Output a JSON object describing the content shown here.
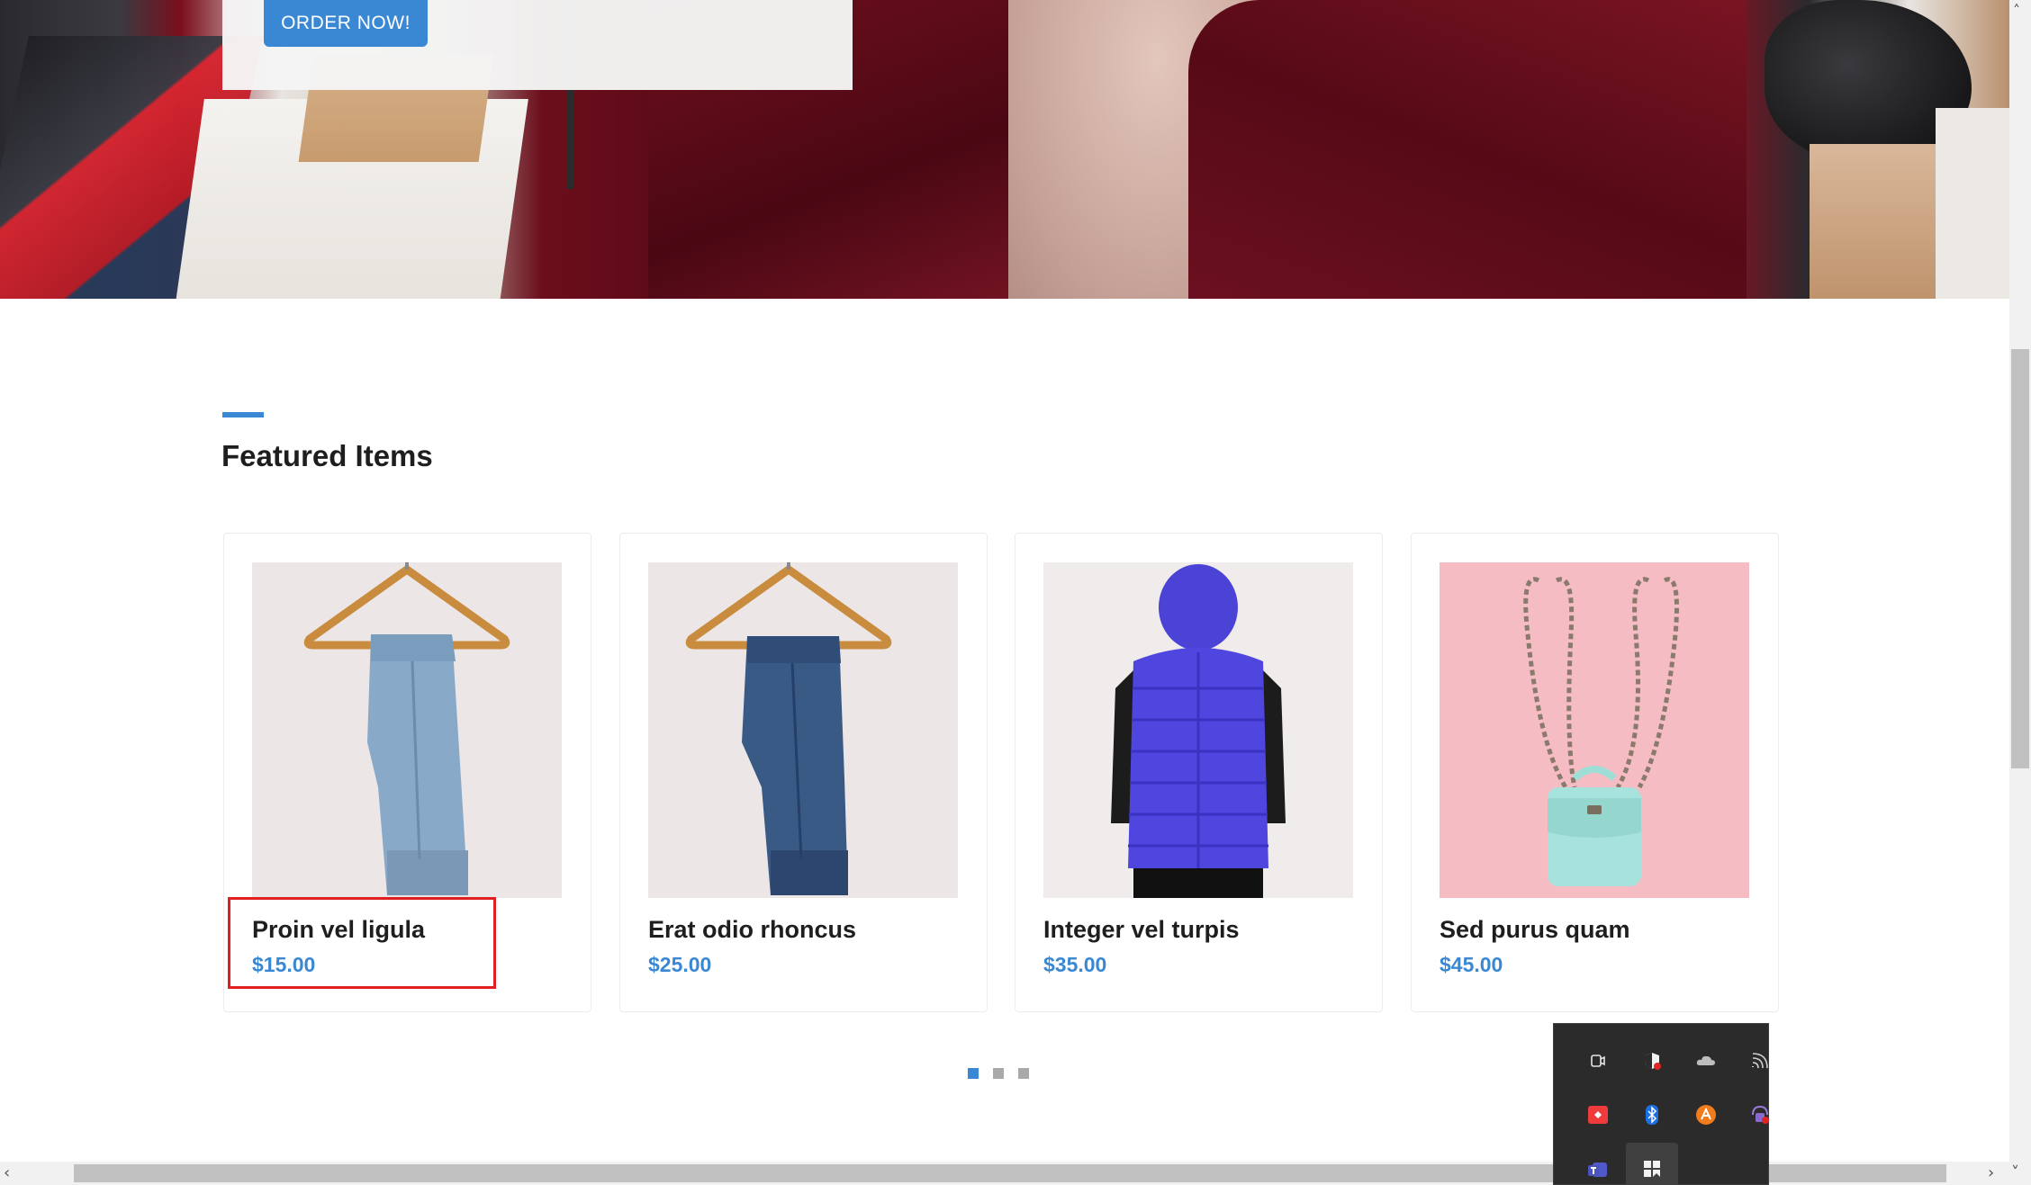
{
  "hero": {
    "order_button_label": "ORDER NOW!"
  },
  "featured": {
    "title": "Featured Items",
    "items": [
      {
        "name": "Proin vel ligula",
        "price": "$15.00",
        "image": "light-jeans-on-hanger"
      },
      {
        "name": "Erat odio rhoncus",
        "price": "$25.00",
        "image": "dark-jeans-on-hanger"
      },
      {
        "name": "Integer vel turpis",
        "price": "$35.00",
        "image": "blue-puffer-vest"
      },
      {
        "name": "Sed purus quam",
        "price": "$45.00",
        "image": "mint-chain-handbag"
      }
    ],
    "carousel_pages": 3,
    "carousel_active_page": 1
  },
  "tray": {
    "icons": [
      "meet-now-icon",
      "security-shield-icon",
      "onedrive-icon",
      "network-icon",
      "anydesk-icon",
      "bluetooth-icon",
      "avast-icon",
      "vpn-lock-icon",
      "teams-icon",
      "app-grid-icon"
    ]
  },
  "colors": {
    "accent": "#3a88d3",
    "highlight": "#e02020"
  }
}
